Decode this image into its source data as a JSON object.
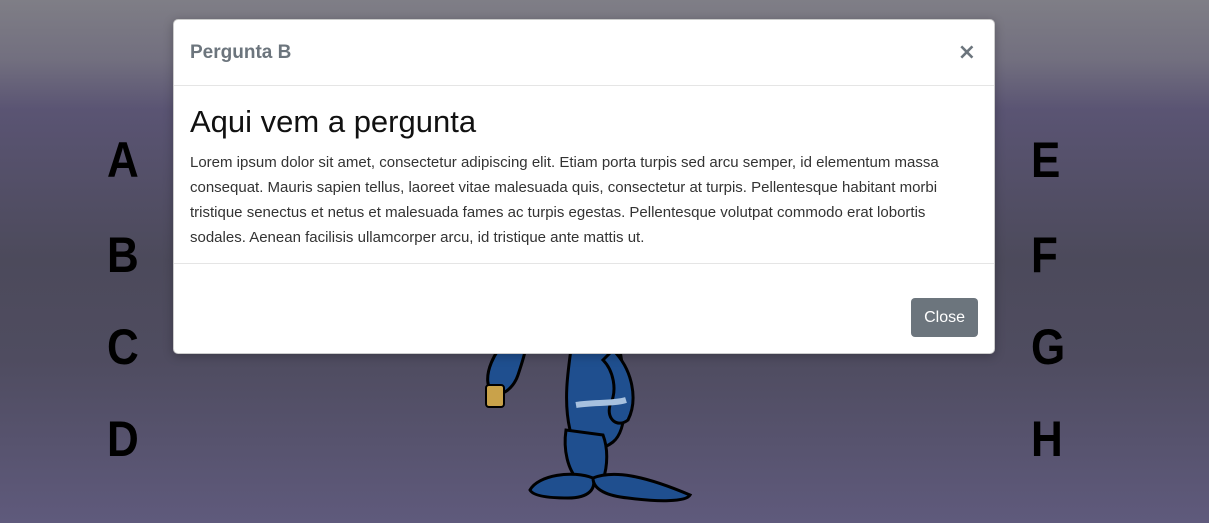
{
  "letters": {
    "left": [
      "A",
      "B",
      "C",
      "D"
    ],
    "right": [
      "E",
      "F",
      "G",
      "H"
    ]
  },
  "modal": {
    "title": "Pergunta B",
    "close_icon": "×",
    "question": "Aqui vem a pergunta",
    "body": "Lorem ipsum dolor sit amet, consectetur adipiscing elit. Etiam porta turpis sed arcu semper, id elementum massa consequat. Mauris sapien tellus, laoreet vitae malesuada quis, consectetur at turpis. Pellentesque habitant morbi tristique senectus et netus et malesuada fames ac turpis egestas. Pellentesque volutpat commodo erat lobortis sodales. Aenean facilisis ullamcorper arcu, id tristique ante mattis ut.",
    "close_button": "Close"
  },
  "colors": {
    "button_bg": "#6c757d",
    "mascot": "#1f4f8f"
  },
  "icons": {
    "close": "close-icon",
    "mascot": "mascot-character"
  }
}
